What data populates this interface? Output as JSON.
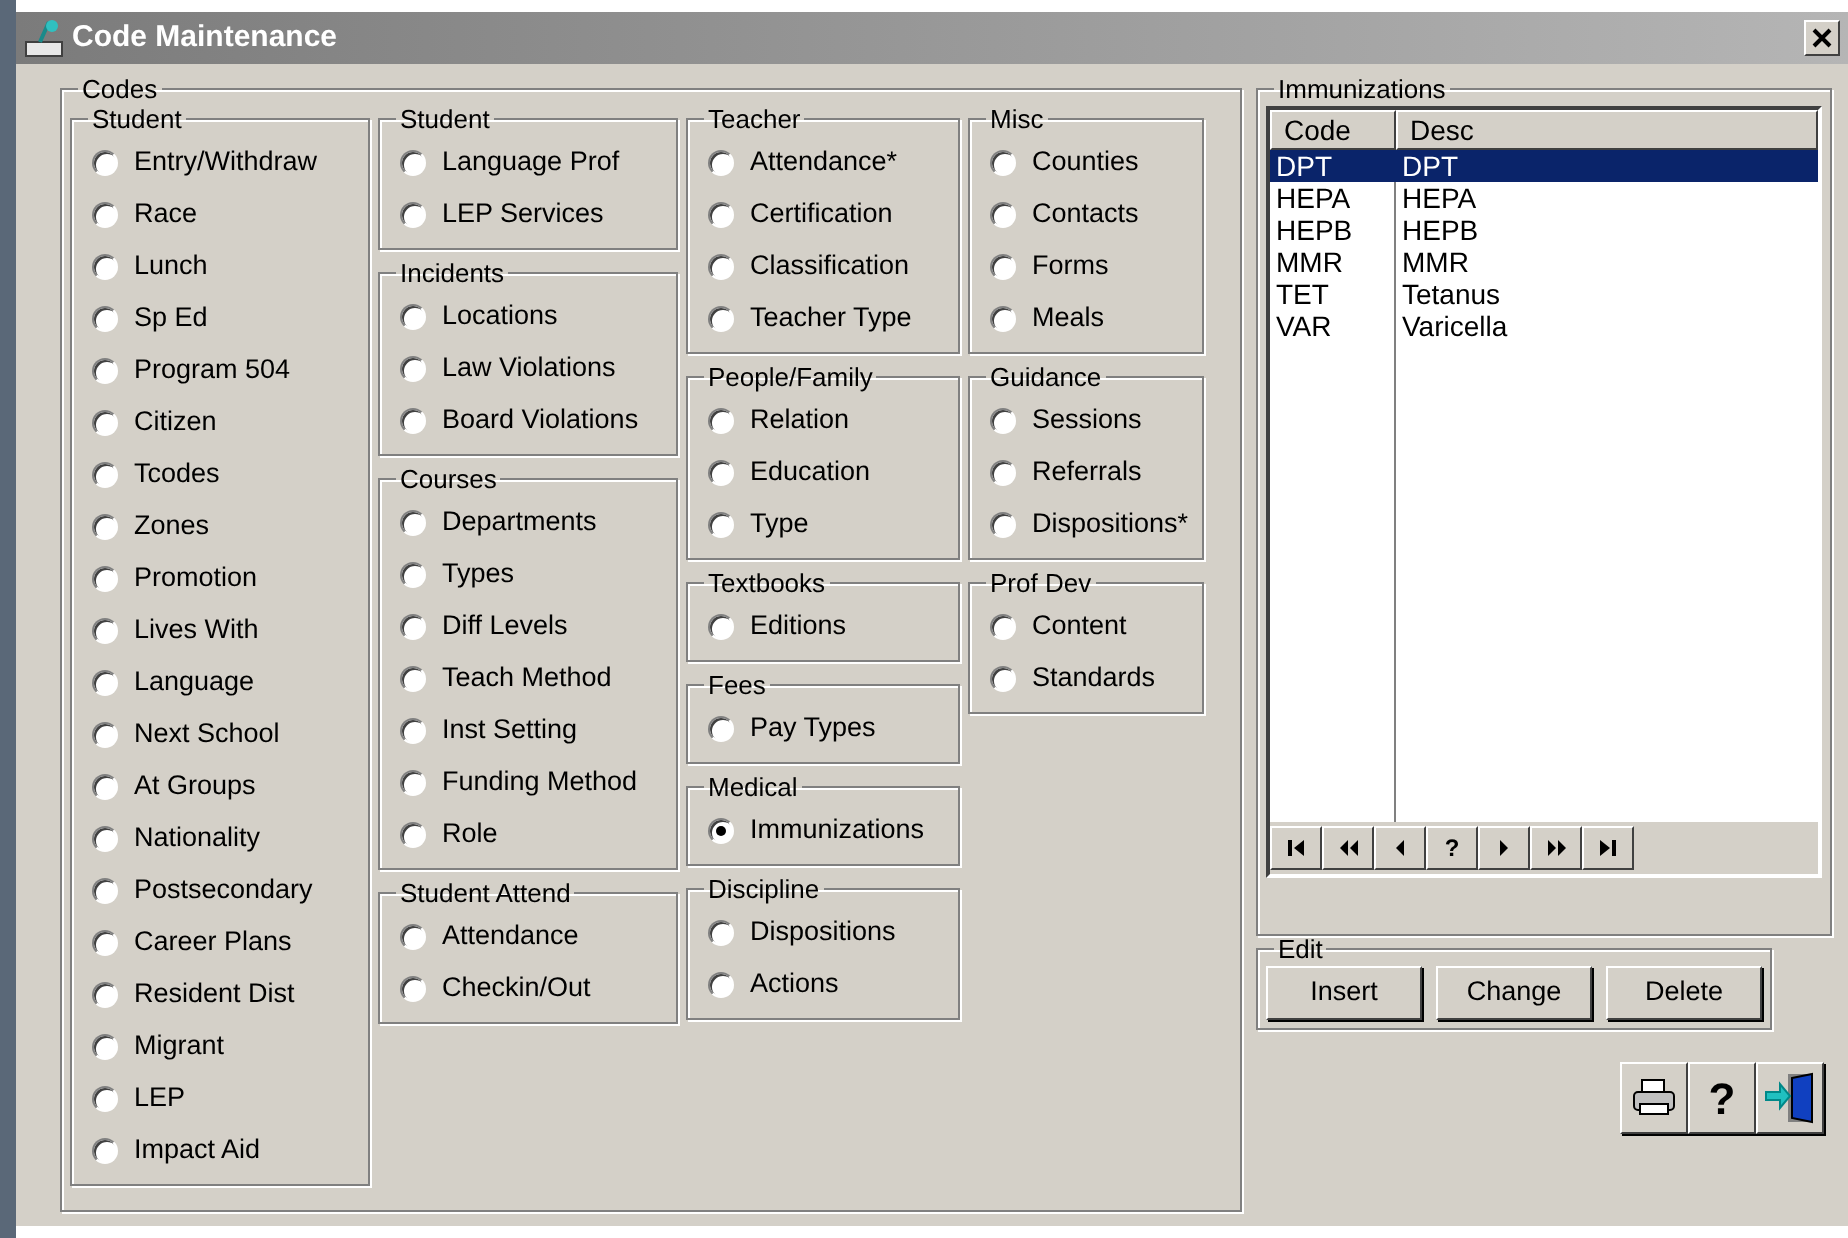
{
  "window": {
    "title": "Code Maintenance"
  },
  "codes": {
    "title": "Codes",
    "columns": [
      [
        {
          "title": "Student",
          "options": [
            {
              "label": "Entry/Withdraw",
              "selected": false
            },
            {
              "label": "Race",
              "selected": false
            },
            {
              "label": "Lunch",
              "selected": false
            },
            {
              "label": "Sp Ed",
              "selected": false
            },
            {
              "label": "Program 504",
              "selected": false
            },
            {
              "label": "Citizen",
              "selected": false
            },
            {
              "label": "Tcodes",
              "selected": false
            },
            {
              "label": "Zones",
              "selected": false
            },
            {
              "label": "Promotion",
              "selected": false
            },
            {
              "label": "Lives With",
              "selected": false
            },
            {
              "label": "Language",
              "selected": false
            },
            {
              "label": "Next School",
              "selected": false
            },
            {
              "label": "At Groups",
              "selected": false
            },
            {
              "label": "Nationality",
              "selected": false
            },
            {
              "label": "Postsecondary",
              "selected": false
            },
            {
              "label": "Career Plans",
              "selected": false
            },
            {
              "label": "Resident Dist",
              "selected": false
            },
            {
              "label": "Migrant",
              "selected": false
            },
            {
              "label": "LEP",
              "selected": false
            },
            {
              "label": "Impact Aid",
              "selected": false
            }
          ]
        }
      ],
      [
        {
          "title": "Student",
          "options": [
            {
              "label": "Language Prof",
              "selected": false
            },
            {
              "label": "LEP Services",
              "selected": false
            }
          ]
        },
        {
          "title": "Incidents",
          "options": [
            {
              "label": "Locations",
              "selected": false
            },
            {
              "label": "Law Violations",
              "selected": false
            },
            {
              "label": "Board Violations",
              "selected": false
            }
          ]
        },
        {
          "title": "Courses",
          "options": [
            {
              "label": "Departments",
              "selected": false
            },
            {
              "label": "Types",
              "selected": false
            },
            {
              "label": "Diff Levels",
              "selected": false
            },
            {
              "label": "Teach Method",
              "selected": false
            },
            {
              "label": "Inst Setting",
              "selected": false
            },
            {
              "label": "Funding Method",
              "selected": false
            },
            {
              "label": "Role",
              "selected": false
            }
          ]
        },
        {
          "title": "Student Attend",
          "options": [
            {
              "label": "Attendance",
              "selected": false
            },
            {
              "label": "Checkin/Out",
              "selected": false
            }
          ]
        }
      ],
      [
        {
          "title": "Teacher",
          "options": [
            {
              "label": "Attendance*",
              "selected": false
            },
            {
              "label": "Certification",
              "selected": false
            },
            {
              "label": "Classification",
              "selected": false
            },
            {
              "label": "Teacher Type",
              "selected": false
            }
          ]
        },
        {
          "title": "People/Family",
          "options": [
            {
              "label": "Relation",
              "selected": false
            },
            {
              "label": "Education",
              "selected": false
            },
            {
              "label": "Type",
              "selected": false
            }
          ]
        },
        {
          "title": "Textbooks",
          "options": [
            {
              "label": "Editions",
              "selected": false
            }
          ]
        },
        {
          "title": "Fees",
          "options": [
            {
              "label": "Pay Types",
              "selected": false
            }
          ]
        },
        {
          "title": "Medical",
          "options": [
            {
              "label": "Immunizations",
              "selected": true
            }
          ]
        },
        {
          "title": "Discipline",
          "options": [
            {
              "label": "Dispositions",
              "selected": false
            },
            {
              "label": "Actions",
              "selected": false
            }
          ]
        }
      ],
      [
        {
          "title": "Misc",
          "options": [
            {
              "label": "Counties",
              "selected": false
            },
            {
              "label": "Contacts",
              "selected": false
            },
            {
              "label": "Forms",
              "selected": false
            },
            {
              "label": "Meals",
              "selected": false
            }
          ]
        },
        {
          "title": "Guidance",
          "options": [
            {
              "label": "Sessions",
              "selected": false
            },
            {
              "label": "Referrals",
              "selected": false
            },
            {
              "label": "Dispositions*",
              "selected": false
            }
          ]
        },
        {
          "title": "Prof Dev",
          "options": [
            {
              "label": "Content",
              "selected": false
            },
            {
              "label": "Standards",
              "selected": false
            }
          ]
        }
      ]
    ]
  },
  "immunizations": {
    "title": "Immunizations",
    "columns": [
      "Code",
      "Desc"
    ],
    "rows": [
      {
        "code": "DPT",
        "desc": "DPT",
        "selected": true
      },
      {
        "code": "HEPA",
        "desc": "HEPA",
        "selected": false
      },
      {
        "code": "HEPB",
        "desc": "HEPB",
        "selected": false
      },
      {
        "code": "MMR",
        "desc": "MMR",
        "selected": false
      },
      {
        "code": "TET",
        "desc": "Tetanus",
        "selected": false
      },
      {
        "code": "VAR",
        "desc": "Varicella",
        "selected": false
      }
    ],
    "navigator_help": "?"
  },
  "edit": {
    "title": "Edit",
    "buttons": [
      {
        "label": "Insert"
      },
      {
        "label": "Change"
      },
      {
        "label": "Delete"
      }
    ]
  },
  "toolbar": {
    "help": "?"
  }
}
